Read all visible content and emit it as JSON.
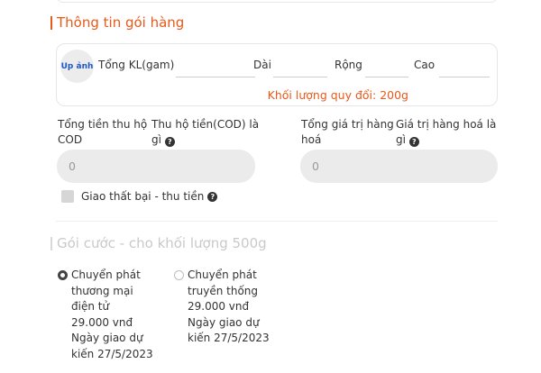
{
  "package_section": {
    "title": "Thông tin gói hàng",
    "photo_button": "Up ảnh",
    "weight_label": "Tổng KL(gam)",
    "length_label": "Dài",
    "width_label": "Rộng",
    "height_label": "Cao",
    "weight_value": "",
    "length_value": "",
    "width_value": "",
    "height_value": "",
    "converted_weight": "Khối lượng quy đổi: 200g"
  },
  "cod": {
    "label": "Tổng tiền thu hộ\nCOD",
    "help_label": "Thu hộ tiền(COD) là\ngì",
    "value": "0"
  },
  "goods_value": {
    "label": "Tổng giá trị hàng\nhoá",
    "help_label": "Giá trị hàng hoá là\ngì",
    "value": "0"
  },
  "failed_delivery": {
    "label": "Giao thất bại - thu tiền",
    "checked": false
  },
  "tariff_section": {
    "title": "Gói cước - cho khối lượng 500g",
    "options": [
      {
        "text": "Chuyển phát\nthương mại\nđiện tử\n29.000 vnđ\nNgày giao dự\nkiến 27/5/2023",
        "selected": true
      },
      {
        "text": "Chuyển phát\ntruyền thống\n29.000 vnđ\nNgày giao dự\nkiến 27/5/2023",
        "selected": false
      }
    ]
  },
  "icons": {
    "help": "question-circle-icon",
    "checkbox": "checkbox-icon",
    "radio_selected": "radio-selected-icon",
    "radio_unselected": "radio-unselected-icon"
  },
  "colors": {
    "accent": "#e8591a",
    "link": "#2158c7",
    "input_bg": "#ebebeb",
    "muted": "#c9c9c9"
  }
}
